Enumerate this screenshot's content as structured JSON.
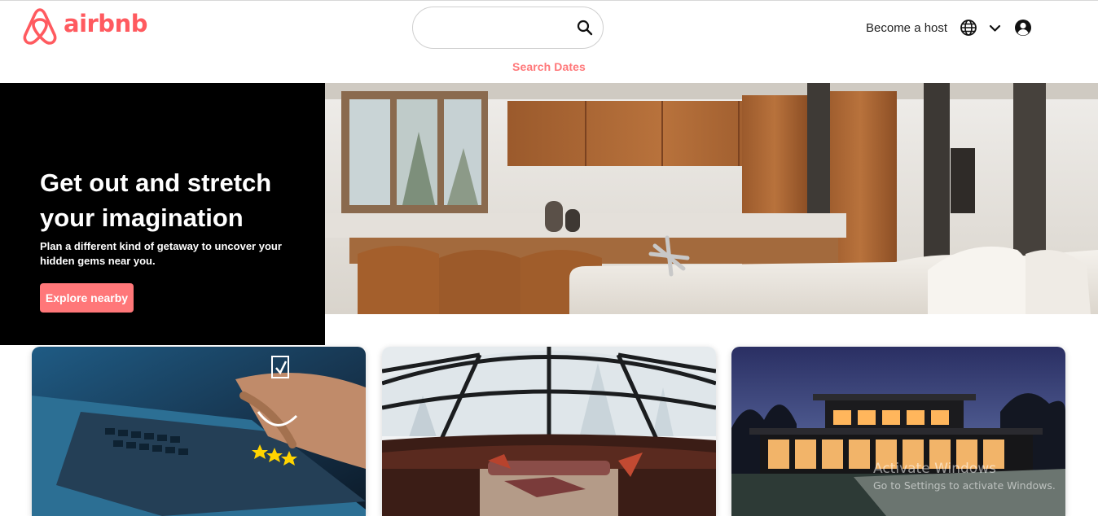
{
  "brand": {
    "name": "airbnb",
    "color": "#ff5a5f"
  },
  "header": {
    "search": {
      "value": "",
      "placeholder": ""
    },
    "search_dates_label": "Search Dates",
    "become_host_label": "Become a host",
    "icons": [
      "search-icon",
      "globe-icon",
      "chevron-down-icon",
      "account-circle-icon"
    ]
  },
  "hero": {
    "title": "Get out and stretch your imagination",
    "subtitle": "Plan a different kind of getaway to uncover your hidden gems near you.",
    "cta_label": "Explore nearby",
    "accent_color": "#ff7779"
  },
  "cards": [
    {
      "image": "laptop-review-stars-image"
    },
    {
      "image": "glass-igloo-snow-image"
    },
    {
      "image": "modern-house-night-image"
    }
  ],
  "os_watermark": {
    "title": "Activate Windows",
    "subtitle": "Go to Settings to activate Windows."
  }
}
